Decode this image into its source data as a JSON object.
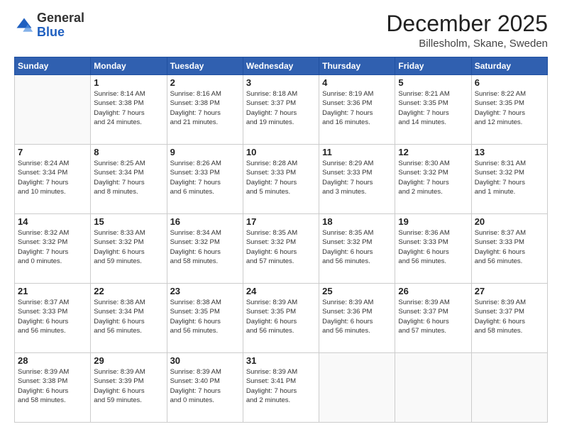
{
  "header": {
    "logo": {
      "general": "General",
      "blue": "Blue"
    },
    "title": "December 2025",
    "location": "Billesholm, Skane, Sweden"
  },
  "weekdays": [
    "Sunday",
    "Monday",
    "Tuesday",
    "Wednesday",
    "Thursday",
    "Friday",
    "Saturday"
  ],
  "weeks": [
    [
      {
        "day": null,
        "info": null
      },
      {
        "day": "1",
        "info": "Sunrise: 8:14 AM\nSunset: 3:38 PM\nDaylight: 7 hours\nand 24 minutes."
      },
      {
        "day": "2",
        "info": "Sunrise: 8:16 AM\nSunset: 3:38 PM\nDaylight: 7 hours\nand 21 minutes."
      },
      {
        "day": "3",
        "info": "Sunrise: 8:18 AM\nSunset: 3:37 PM\nDaylight: 7 hours\nand 19 minutes."
      },
      {
        "day": "4",
        "info": "Sunrise: 8:19 AM\nSunset: 3:36 PM\nDaylight: 7 hours\nand 16 minutes."
      },
      {
        "day": "5",
        "info": "Sunrise: 8:21 AM\nSunset: 3:35 PM\nDaylight: 7 hours\nand 14 minutes."
      },
      {
        "day": "6",
        "info": "Sunrise: 8:22 AM\nSunset: 3:35 PM\nDaylight: 7 hours\nand 12 minutes."
      }
    ],
    [
      {
        "day": "7",
        "info": "Sunrise: 8:24 AM\nSunset: 3:34 PM\nDaylight: 7 hours\nand 10 minutes."
      },
      {
        "day": "8",
        "info": "Sunrise: 8:25 AM\nSunset: 3:34 PM\nDaylight: 7 hours\nand 8 minutes."
      },
      {
        "day": "9",
        "info": "Sunrise: 8:26 AM\nSunset: 3:33 PM\nDaylight: 7 hours\nand 6 minutes."
      },
      {
        "day": "10",
        "info": "Sunrise: 8:28 AM\nSunset: 3:33 PM\nDaylight: 7 hours\nand 5 minutes."
      },
      {
        "day": "11",
        "info": "Sunrise: 8:29 AM\nSunset: 3:33 PM\nDaylight: 7 hours\nand 3 minutes."
      },
      {
        "day": "12",
        "info": "Sunrise: 8:30 AM\nSunset: 3:32 PM\nDaylight: 7 hours\nand 2 minutes."
      },
      {
        "day": "13",
        "info": "Sunrise: 8:31 AM\nSunset: 3:32 PM\nDaylight: 7 hours\nand 1 minute."
      }
    ],
    [
      {
        "day": "14",
        "info": "Sunrise: 8:32 AM\nSunset: 3:32 PM\nDaylight: 7 hours\nand 0 minutes."
      },
      {
        "day": "15",
        "info": "Sunrise: 8:33 AM\nSunset: 3:32 PM\nDaylight: 6 hours\nand 59 minutes."
      },
      {
        "day": "16",
        "info": "Sunrise: 8:34 AM\nSunset: 3:32 PM\nDaylight: 6 hours\nand 58 minutes."
      },
      {
        "day": "17",
        "info": "Sunrise: 8:35 AM\nSunset: 3:32 PM\nDaylight: 6 hours\nand 57 minutes."
      },
      {
        "day": "18",
        "info": "Sunrise: 8:35 AM\nSunset: 3:32 PM\nDaylight: 6 hours\nand 56 minutes."
      },
      {
        "day": "19",
        "info": "Sunrise: 8:36 AM\nSunset: 3:33 PM\nDaylight: 6 hours\nand 56 minutes."
      },
      {
        "day": "20",
        "info": "Sunrise: 8:37 AM\nSunset: 3:33 PM\nDaylight: 6 hours\nand 56 minutes."
      }
    ],
    [
      {
        "day": "21",
        "info": "Sunrise: 8:37 AM\nSunset: 3:33 PM\nDaylight: 6 hours\nand 56 minutes."
      },
      {
        "day": "22",
        "info": "Sunrise: 8:38 AM\nSunset: 3:34 PM\nDaylight: 6 hours\nand 56 minutes."
      },
      {
        "day": "23",
        "info": "Sunrise: 8:38 AM\nSunset: 3:35 PM\nDaylight: 6 hours\nand 56 minutes."
      },
      {
        "day": "24",
        "info": "Sunrise: 8:39 AM\nSunset: 3:35 PM\nDaylight: 6 hours\nand 56 minutes."
      },
      {
        "day": "25",
        "info": "Sunrise: 8:39 AM\nSunset: 3:36 PM\nDaylight: 6 hours\nand 56 minutes."
      },
      {
        "day": "26",
        "info": "Sunrise: 8:39 AM\nSunset: 3:37 PM\nDaylight: 6 hours\nand 57 minutes."
      },
      {
        "day": "27",
        "info": "Sunrise: 8:39 AM\nSunset: 3:37 PM\nDaylight: 6 hours\nand 58 minutes."
      }
    ],
    [
      {
        "day": "28",
        "info": "Sunrise: 8:39 AM\nSunset: 3:38 PM\nDaylight: 6 hours\nand 58 minutes."
      },
      {
        "day": "29",
        "info": "Sunrise: 8:39 AM\nSunset: 3:39 PM\nDaylight: 6 hours\nand 59 minutes."
      },
      {
        "day": "30",
        "info": "Sunrise: 8:39 AM\nSunset: 3:40 PM\nDaylight: 7 hours\nand 0 minutes."
      },
      {
        "day": "31",
        "info": "Sunrise: 8:39 AM\nSunset: 3:41 PM\nDaylight: 7 hours\nand 2 minutes."
      },
      {
        "day": null,
        "info": null
      },
      {
        "day": null,
        "info": null
      },
      {
        "day": null,
        "info": null
      }
    ]
  ]
}
